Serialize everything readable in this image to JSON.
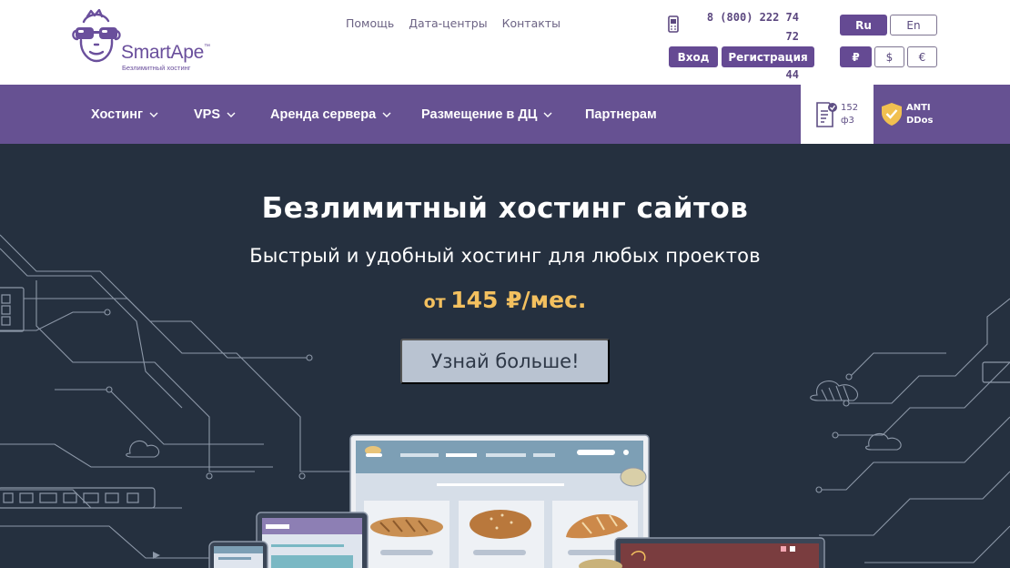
{
  "header": {
    "logo_name": "SmartApe",
    "logo_tm": "™",
    "logo_tagline": "Безлимитный хостинг",
    "top_links": [
      "Помощь",
      "Дата-центры",
      "Контакты"
    ],
    "phones": [
      "8 (800) 222 74 72",
      "+7 (495) 565 37 44"
    ],
    "login_label": "Вход",
    "register_label": "Регистрация",
    "languages": [
      {
        "label": "Ru",
        "active": true
      },
      {
        "label": "En",
        "active": false
      }
    ],
    "currencies": [
      {
        "label": "₽",
        "active": true
      },
      {
        "label": "$",
        "active": false
      },
      {
        "label": "€",
        "active": false
      }
    ],
    "icons": {
      "phone": "mobile-phone-icon",
      "logo": "monkey-glasses-logo"
    }
  },
  "nav": {
    "items": [
      {
        "label": "Хостинг",
        "dropdown": true
      },
      {
        "label": "VPS",
        "dropdown": true
      },
      {
        "label": "Аренда сервера",
        "dropdown": true
      },
      {
        "label": "Размещение в ДЦ",
        "dropdown": true
      },
      {
        "label": "Партнерам",
        "dropdown": false
      }
    ],
    "fz_line1": "152",
    "fz_line2": "ф3",
    "ddos_line1": "ANTI",
    "ddos_line2": "DDos",
    "icons": {
      "fz": "document-check-icon",
      "ddos": "shield-check-icon"
    }
  },
  "hero": {
    "title": "Безлимитный хостинг сайтов",
    "subtitle": "Быстрый и удобный хостинг для любых проектов",
    "price_prefix": "от",
    "price_value": "145 ₽/мес.",
    "cta_label": "Узнай больше!"
  },
  "colors": {
    "brand_purple": "#665192",
    "hero_bg": "#25303f",
    "price_yellow": "#f3c05f",
    "cta_bg": "#b9c3d1"
  }
}
